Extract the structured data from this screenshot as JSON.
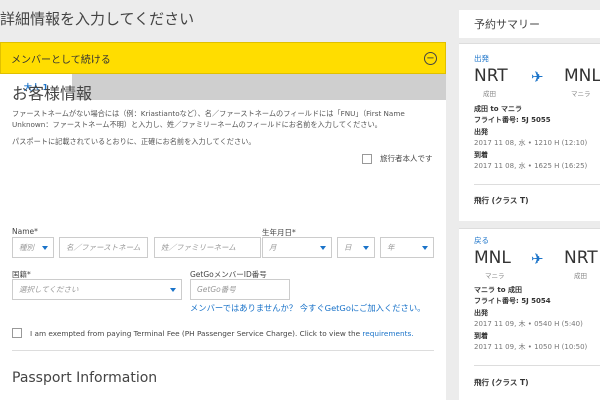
{
  "page_title": "詳細情報を入力してください",
  "member_bar": {
    "label": "メンバーとして続ける",
    "collapse_icon": "minus"
  },
  "tabs": [
    {
      "label": "大人 1"
    }
  ],
  "section_title": "お客様情報",
  "notes": [
    "ファーストネームがない場合には（例：Kriastiantoなど）、名／ファーストネームのフィールドには「FNU」（First Name Unknown：ファーストネーム不明）と入力し、姓／ファミリーネームのフィールドにお名前を入力してください。",
    "パスポートに記載されているとおりに、正確にお名前を入力してください。"
  ],
  "traveler_self": "旅行者本人です",
  "name": {
    "label": "Name*",
    "title_placeholder": "種別",
    "first_placeholder": "名／ファーストネーム",
    "last_placeholder": "姓／ファミリーネーム"
  },
  "dob": {
    "label": "生年月日*",
    "month_placeholder": "月",
    "day_placeholder": "日",
    "year_placeholder": "年"
  },
  "nationality": {
    "label": "国籍*",
    "placeholder": "選択してください"
  },
  "getgo": {
    "label": "GetGoメンバーID番号",
    "placeholder": "GetGo番号",
    "link": "メンバーではありませんか？ 今すぐGetGoにご加入ください。"
  },
  "exempt": {
    "text": "I am exempted from paying Terminal Fee (PH Passenger Service Charge). Click to view the",
    "link": "requirements."
  },
  "passport_title": "Passport Information",
  "summary": {
    "title": "予約サマリー",
    "outbound": {
      "direction": "出発",
      "from_code": "NRT",
      "from_city": "成田",
      "to_code": "MNL",
      "to_city": "マニラ",
      "route": "成田 to マニラ",
      "flight": "フライト番号: 5J 5055",
      "depart_label": "出発",
      "depart_time": "2017 11 08, 水 • 1210 H (12:10)",
      "arrive_label": "到着",
      "arrive_time": "2017 11 08, 水 • 1625 H (16:25)",
      "fare": "飛行 (クラス T)"
    },
    "return": {
      "direction": "戻る",
      "from_code": "MNL",
      "from_city": "マニラ",
      "to_code": "NRT",
      "to_city": "成田",
      "route": "マニラ to 成田",
      "flight": "フライト番号: 5J 5054",
      "depart_label": "出発",
      "depart_time": "2017 11 09, 木 • 0540 H (5:40)",
      "arrive_label": "到着",
      "arrive_time": "2017 11 09, 木 • 1050 H (10:50)",
      "fare": "飛行 (クラス T)"
    }
  },
  "colors": {
    "accent": "#1a73c9",
    "member_bar": "#ffdd00"
  }
}
